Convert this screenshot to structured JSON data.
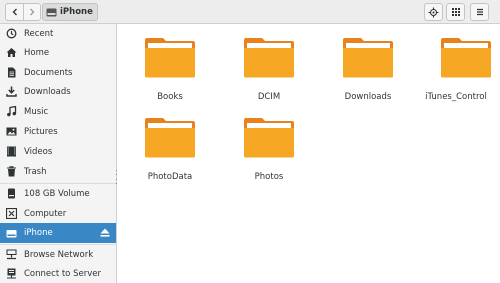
{
  "header": {
    "back_icon": "chevron-left-icon",
    "forward_icon": "chevron-right-icon",
    "location": "iPhone",
    "location_icon": "drive-icon",
    "tools": [
      {
        "icon": "locate-icon"
      },
      {
        "icon": "grid-view-icon"
      },
      {
        "icon": "menu-icon"
      }
    ]
  },
  "sidebar": {
    "places": [
      {
        "label": "Recent",
        "icon": "clock-icon"
      },
      {
        "label": "Home",
        "icon": "home-icon"
      },
      {
        "label": "Documents",
        "icon": "document-icon"
      },
      {
        "label": "Downloads",
        "icon": "download-icon"
      },
      {
        "label": "Music",
        "icon": "music-icon"
      },
      {
        "label": "Pictures",
        "icon": "picture-icon"
      },
      {
        "label": "Videos",
        "icon": "video-icon"
      },
      {
        "label": "Trash",
        "icon": "trash-icon"
      }
    ],
    "devices": [
      {
        "label": "108 GB Volume",
        "icon": "drive-icon"
      },
      {
        "label": "Computer",
        "icon": "computer-icon"
      },
      {
        "label": "iPhone",
        "icon": "drive-icon",
        "selected": true,
        "eject_icon": "eject-icon"
      }
    ],
    "network": [
      {
        "label": "Browse Network",
        "icon": "network-icon"
      },
      {
        "label": "Connect to Server",
        "icon": "server-icon"
      }
    ]
  },
  "folders": [
    {
      "name": "Books"
    },
    {
      "name": "DCIM"
    },
    {
      "name": "Downloads"
    },
    {
      "name": "iTunes_Control"
    },
    {
      "name": "PhotoData"
    },
    {
      "name": "Photos"
    }
  ],
  "colors": {
    "accent": "#3a87c6",
    "folder_body": "#f5a623",
    "folder_back": "#e8821c",
    "folder_paper": "#ffffff"
  }
}
